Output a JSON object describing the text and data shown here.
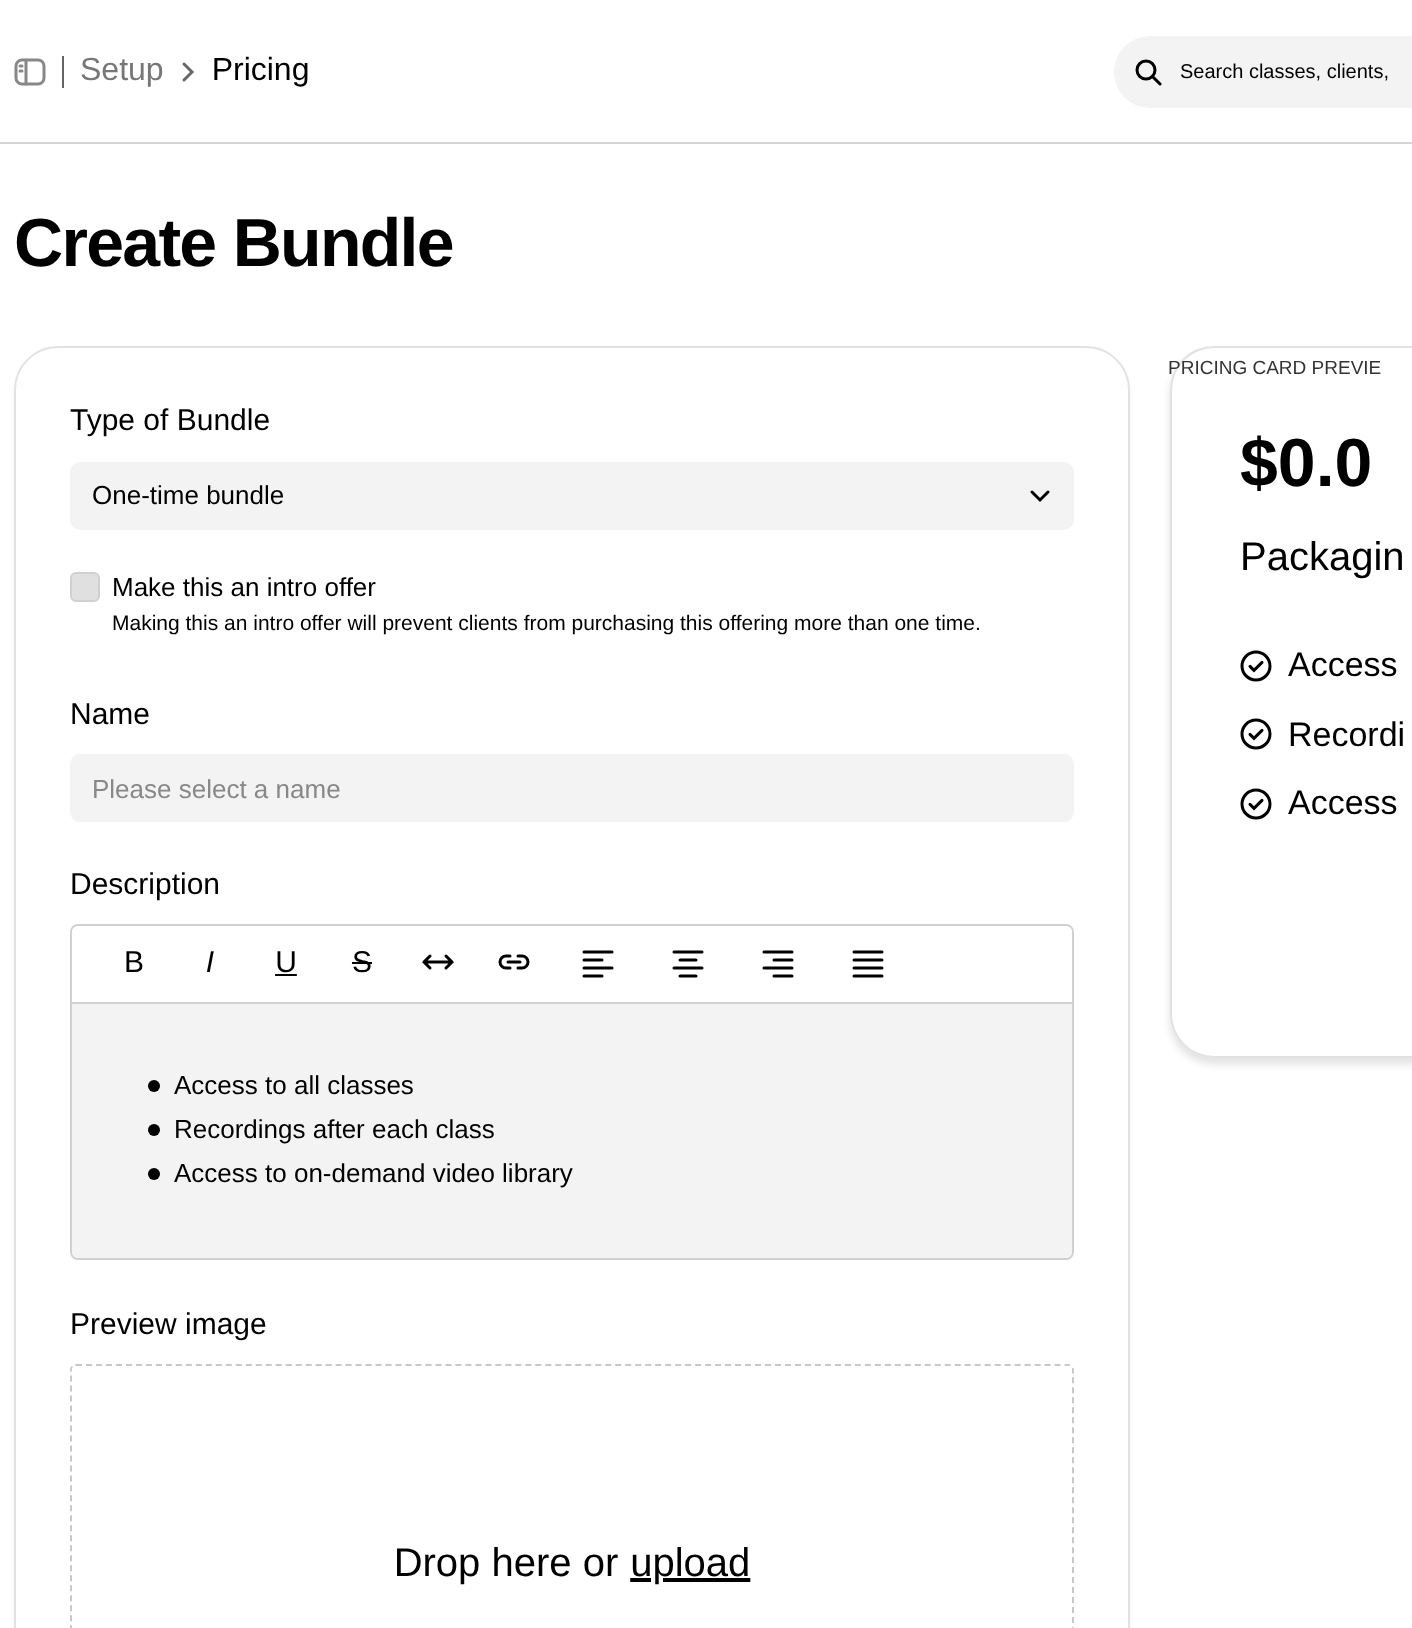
{
  "breadcrumb": {
    "items": [
      "Setup",
      "Pricing"
    ]
  },
  "search": {
    "placeholder": "Search classes, clients,"
  },
  "title": "Create Bundle",
  "form": {
    "type_label": "Type of Bundle",
    "type_value": "One-time bundle",
    "intro_offer": {
      "label": "Make this an intro offer",
      "checked": false,
      "hint": "Making this an intro offer will prevent clients from purchasing this offering more than one time."
    },
    "name_label": "Name",
    "name_placeholder": "Please select a name",
    "description_label": "Description",
    "toolbar": [
      "B",
      "I",
      "U",
      "S"
    ],
    "description_items": [
      "Access to all classes",
      "Recordings after each class",
      "Access to on-demand video library"
    ],
    "preview_label": "Preview image",
    "drop_text": "Drop here or",
    "drop_link": "upload"
  },
  "preview": {
    "label": "PRICING CARD PREVIE",
    "price": "$0.0",
    "name": "Packagin",
    "features": [
      "Access",
      "Recordi",
      "Access"
    ]
  }
}
